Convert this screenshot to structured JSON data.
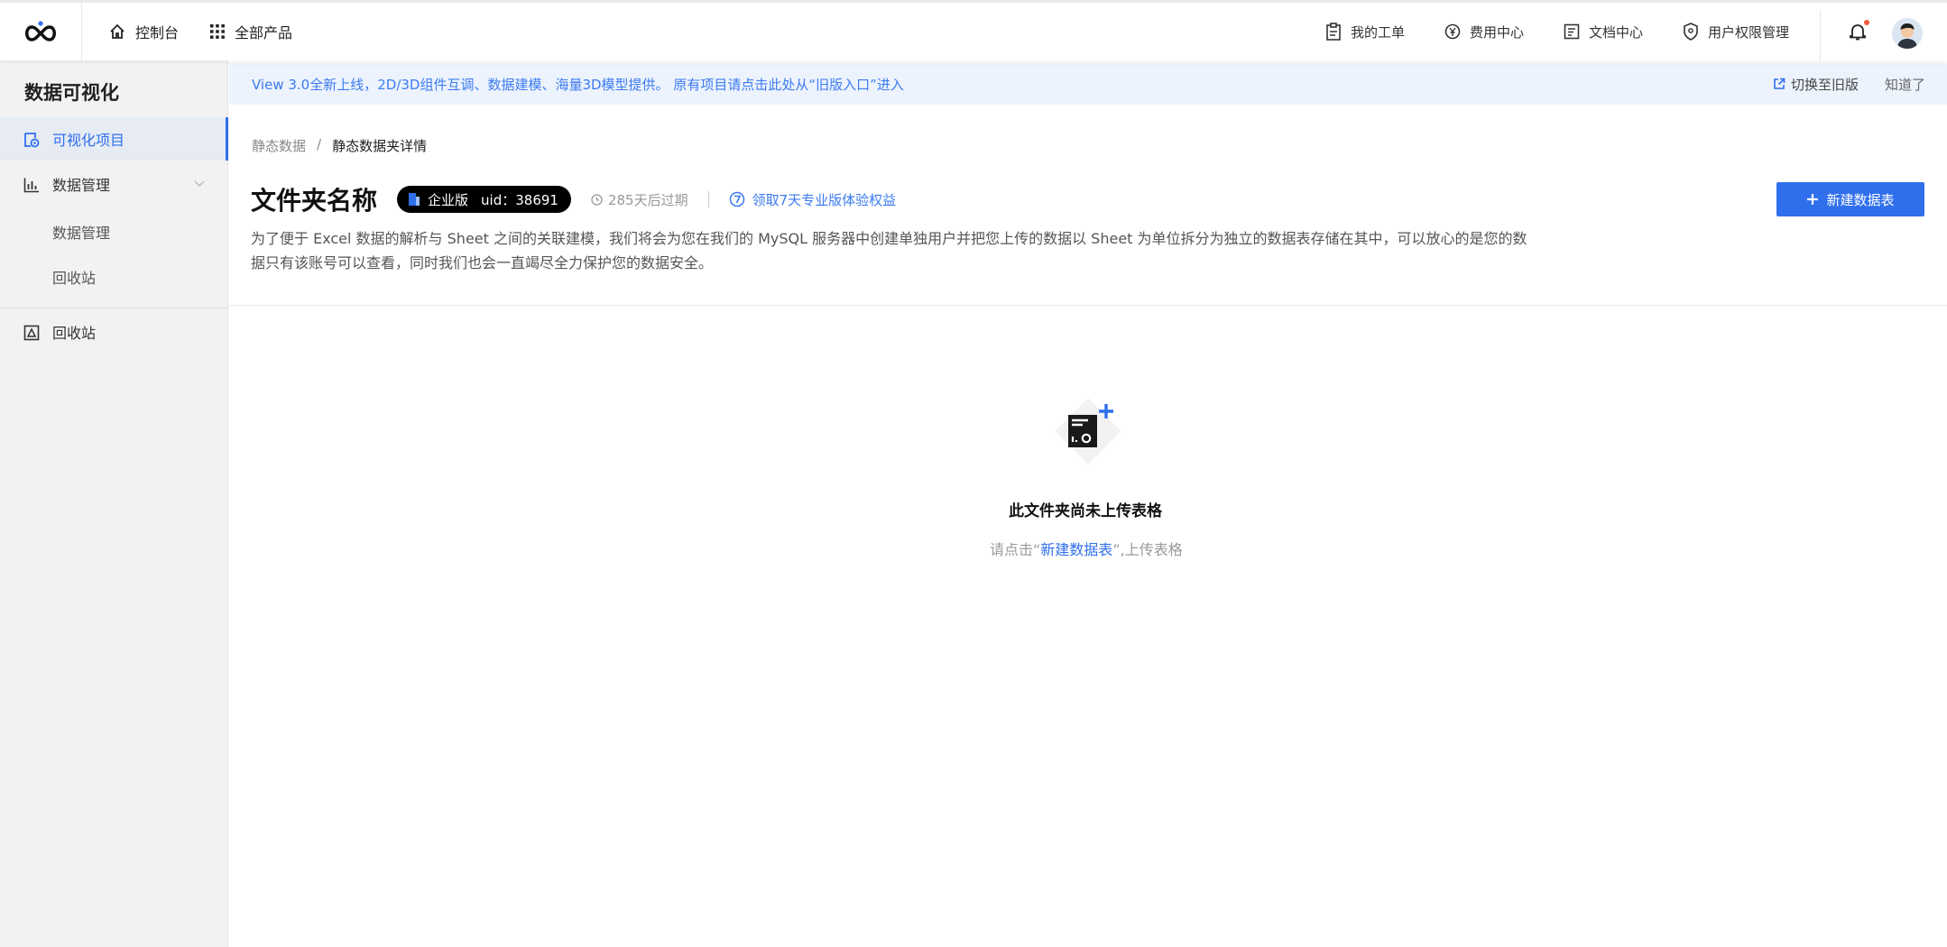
{
  "topbar": {
    "logo_icon": "infinity-logo-icon",
    "console_label": "控制台",
    "products_label": "全部产品",
    "tickets_label": "我的工单",
    "billing_label": "费用中心",
    "docs_label": "文档中心",
    "permissions_label": "用户权限管理"
  },
  "sidebar": {
    "title": "数据可视化",
    "items": [
      {
        "label": "可视化项目",
        "icon": "visual-project-icon",
        "active": true
      },
      {
        "label": "数据管理",
        "icon": "bar-chart-icon"
      },
      {
        "label": "数据管理"
      },
      {
        "label": "回收站"
      },
      {
        "label": "回收站",
        "icon": "recycle-icon"
      }
    ]
  },
  "banner": {
    "text": "View 3.0全新上线，2D/3D组件互调、数据建模、海量3D模型提供。 原有项目请点击此处从“旧版入口”进入",
    "switch_label": "切换至旧版",
    "ok_label": "知道了"
  },
  "breadcrumb": {
    "parent": "静态数据",
    "separator": "/",
    "current": "静态数据夹详情"
  },
  "header": {
    "title": "文件夹名称",
    "edition": "企业版",
    "uid": "uid：38691",
    "expire": "285天后过期",
    "trial_link": "领取7天专业版体验权益",
    "new_button": "新建数据表",
    "description": "为了便于 Excel 数据的解析与 Sheet 之间的关联建模，我们将会为您在我们的 MySQL 服务器中创建单独用户并把您上传的数据以 Sheet 为单位拆分为独立的数据表存储在其中，可以放心的是您的数据只有该账号可以查看，同时我们也会一直竭尽全力保护您的数据安全。"
  },
  "empty": {
    "title": "此文件夹尚未上传表格",
    "tip_prefix": "请点击“",
    "tip_link": "新建数据表",
    "tip_suffix": "”,上传表格"
  },
  "colors": {
    "accent": "#2f6fec",
    "banner_bg": "#edf3fd",
    "sidebar_bg": "#f2f2f2"
  }
}
